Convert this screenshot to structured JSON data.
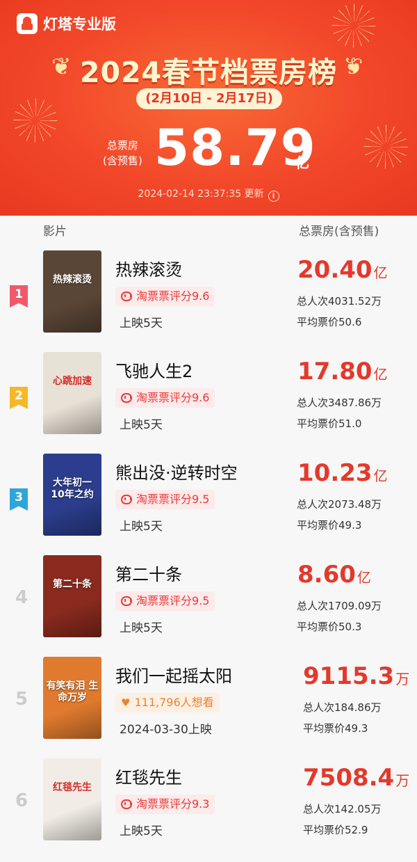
{
  "app": {
    "name": "灯塔专业版"
  },
  "header": {
    "title": "2024春节档票房榜",
    "date_range": "(2月10日 - 2月17日)",
    "total_label_line1": "总票房",
    "total_label_line2": "(含预售)",
    "total_value": "58.79",
    "total_unit": "亿",
    "update_time": "2024-02-14 23:37:35 更新"
  },
  "columns": {
    "film": "影片",
    "gross": "总票房(含预售)"
  },
  "movies": [
    {
      "rank": "1",
      "title": "热辣滚烫",
      "rating_type": "rating",
      "rating": "淘票票评分9.6",
      "release": "上映5天",
      "gross": "20.40",
      "unit": "亿",
      "admissions": "总人次4031.52万",
      "avg_price": "平均票价50.6",
      "poster_text": "热辣滚烫",
      "poster_color": "#5a4636",
      "badge_color": "#f0596c"
    },
    {
      "rank": "2",
      "title": "飞驰人生2",
      "rating_type": "rating",
      "rating": "淘票票评分9.6",
      "release": "上映5天",
      "gross": "17.80",
      "unit": "亿",
      "admissions": "总人次3487.86万",
      "avg_price": "平均票价51.0",
      "poster_text": "心跳加速",
      "poster_color": "#e8e1d6",
      "badge_color": "#f5b82a"
    },
    {
      "rank": "3",
      "title": "熊出没·逆转时空",
      "rating_type": "rating",
      "rating": "淘票票评分9.5",
      "release": "上映5天",
      "gross": "10.23",
      "unit": "亿",
      "admissions": "总人次2073.48万",
      "avg_price": "平均票价49.3",
      "poster_text": "大年初一 10年之约",
      "poster_color": "#2b3d8c",
      "badge_color": "#2ea6d9"
    },
    {
      "rank": "4",
      "title": "第二十条",
      "rating_type": "rating",
      "rating": "淘票票评分9.5",
      "release": "上映5天",
      "gross": "8.60",
      "unit": "亿",
      "admissions": "总人次1709.09万",
      "avg_price": "平均票价50.3",
      "poster_text": "第二十条",
      "poster_color": "#8a2a1e",
      "badge_color": ""
    },
    {
      "rank": "5",
      "title": "我们一起摇太阳",
      "rating_type": "want",
      "rating": "111,796人想看",
      "release": "2024-03-30上映",
      "gross": "9115.3",
      "unit": "万",
      "admissions": "总人次184.86万",
      "avg_price": "平均票价49.3",
      "poster_text": "有笑有泪 生命万岁",
      "poster_color": "#e07a2e",
      "badge_color": ""
    },
    {
      "rank": "6",
      "title": "红毯先生",
      "rating_type": "rating",
      "rating": "淘票票评分9.3",
      "release": "上映5天",
      "gross": "7508.4",
      "unit": "万",
      "admissions": "总人次142.05万",
      "avg_price": "平均票价52.9",
      "poster_text": "红毯先生",
      "poster_color": "#f1ede6",
      "badge_color": ""
    }
  ],
  "colors": {
    "accent": "#f2472a",
    "gross": "#e3392c",
    "rating": "#e83a3a"
  }
}
